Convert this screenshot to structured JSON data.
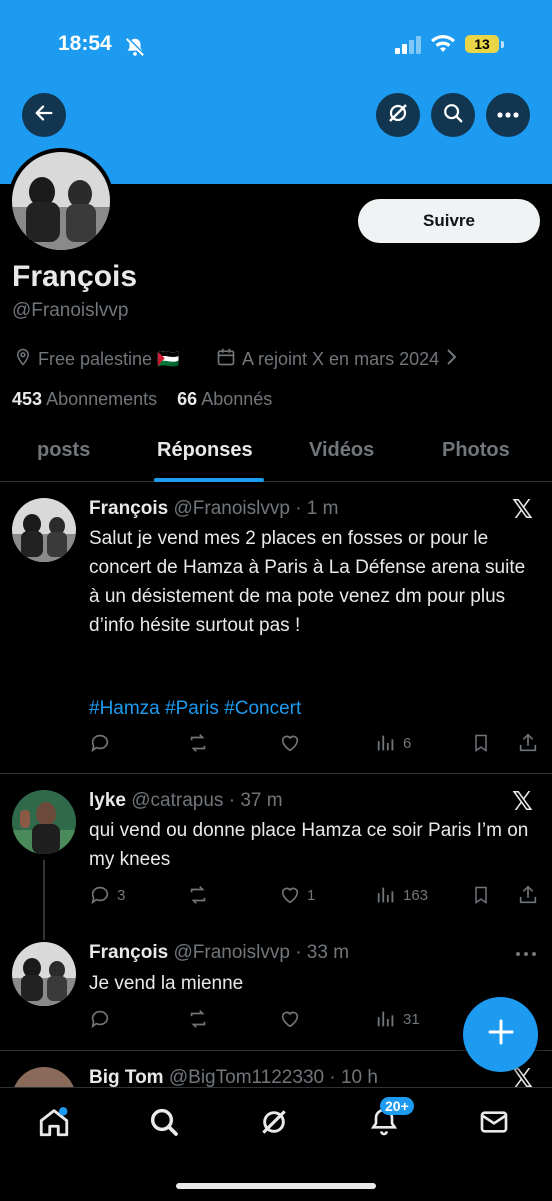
{
  "status": {
    "time": "18:54",
    "battery": "13"
  },
  "profile": {
    "name": "François",
    "handle": "@Franoislvvp",
    "location": "Free palestine 🇵🇸",
    "joined": "A rejoint X en mars 2024",
    "following_count": "453",
    "following_label": "Abonnements",
    "followers_count": "66",
    "followers_label": "Abonnés",
    "follow_button": "Suivre"
  },
  "tabs": [
    "posts",
    "Réponses",
    "Vidéos",
    "Photos"
  ],
  "active_tab": "Réponses",
  "posts": [
    {
      "name": "François",
      "handle": "@Franoislvvp",
      "time": "· 1 m",
      "text": "Salut je vend mes 2 places en fosses or pour le concert de Hamza à Paris à La Défense arena suite à un désistement de ma pote venez dm pour plus d’info hésite surtout pas !",
      "tags": "#Hamza #Paris #Concert",
      "views": "6"
    },
    {
      "name": "lyke",
      "handle": "@catrapus",
      "time": "· 37 m",
      "text": "qui vend ou donne place Hamza ce soir Paris I’m on my knees",
      "replies": "3",
      "likes": "1",
      "views": "163"
    },
    {
      "name": "François",
      "handle": "@Franoislvvp",
      "time": "· 33 m",
      "text": "Je vend la mienne",
      "views": "31"
    },
    {
      "name": "Big Tom",
      "handle": "@BigTom1122330",
      "time": "· 10 h"
    }
  ],
  "nav": {
    "notifications_badge": "20+"
  },
  "colors": {
    "accent": "#1d9bf0",
    "background": "#000000",
    "muted": "#71767b"
  }
}
